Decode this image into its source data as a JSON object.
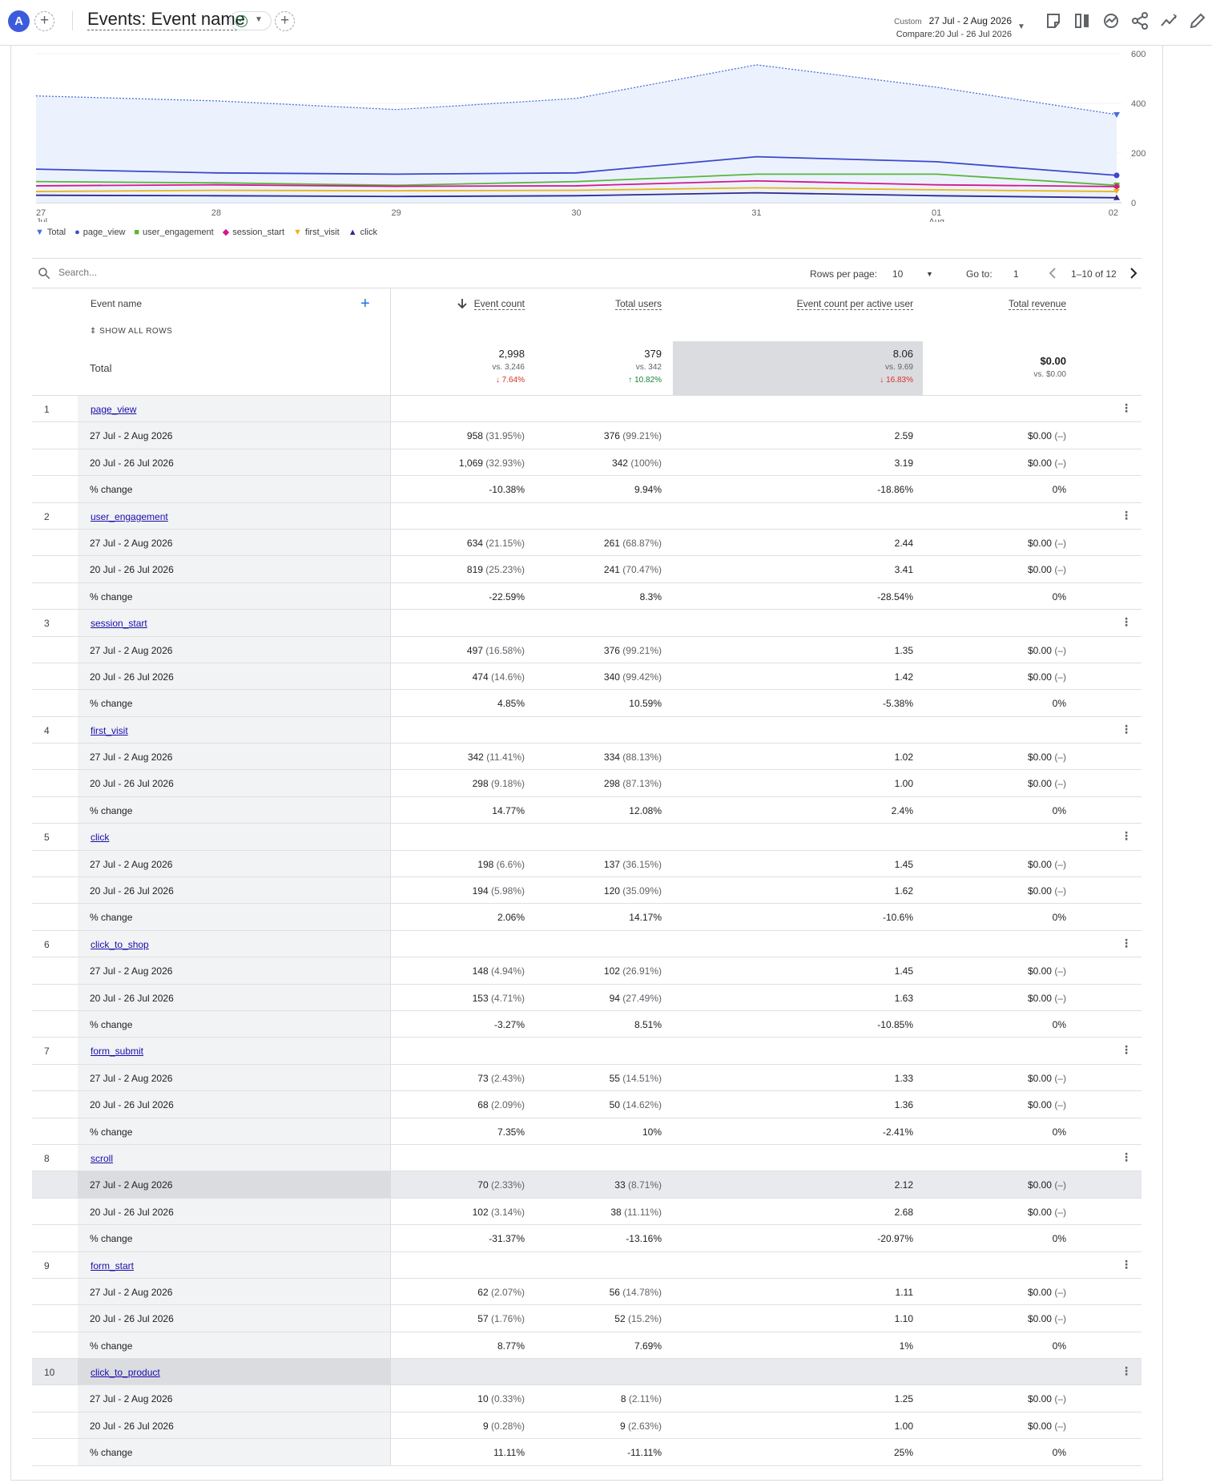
{
  "header": {
    "avatar_letter": "A",
    "add_label": "+",
    "title": "Events: Event name",
    "add_comparison_label": "+",
    "date_custom": "Custom",
    "date_range": "27 Jul - 2 Aug 2026",
    "compare_range": "Compare:20 Jul - 26 Jul 2026",
    "toolbar_icons": [
      "annotation-icon",
      "compare-columns-icon",
      "insights-icon",
      "share-icon",
      "trend-icon",
      "edit-icon"
    ]
  },
  "chart_data": {
    "type": "line",
    "x": [
      "27 Jul",
      "28",
      "29",
      "30",
      "31",
      "01 Aug",
      "02"
    ],
    "tick_labels": [
      [
        "27",
        "Jul"
      ],
      [
        "28",
        ""
      ],
      [
        "29",
        ""
      ],
      [
        "30",
        ""
      ],
      [
        "31",
        ""
      ],
      [
        "01",
        "Aug"
      ],
      [
        "02",
        ""
      ]
    ],
    "ylim": [
      0,
      600
    ],
    "yticks": [
      "600",
      "400",
      "200",
      "0"
    ],
    "ytick_values": [
      600,
      400,
      200,
      0
    ],
    "legend_position": "bottom-left",
    "series": [
      {
        "name": "Total",
        "color": "#4a6fd8",
        "style": "dotted-area",
        "values": [
          430,
          410,
          375,
          420,
          555,
          465,
          355
        ]
      },
      {
        "name": "page_view",
        "color": "#3b48cc",
        "values": [
          135,
          120,
          115,
          120,
          185,
          165,
          110
        ]
      },
      {
        "name": "user_engagement",
        "color": "#59b539",
        "values": [
          85,
          80,
          70,
          85,
          115,
          115,
          70
        ]
      },
      {
        "name": "session_start",
        "color": "#d4178a",
        "values": [
          68,
          72,
          66,
          68,
          88,
          72,
          65
        ]
      },
      {
        "name": "first_visit",
        "color": "#e8b61a",
        "values": [
          45,
          50,
          48,
          50,
          60,
          52,
          45
        ]
      },
      {
        "name": "click",
        "color": "#2f2a8a",
        "values": [
          30,
          28,
          25,
          28,
          40,
          28,
          20
        ]
      }
    ]
  },
  "search": {
    "placeholder": "Search..."
  },
  "pagination": {
    "rows_label": "Rows per page:",
    "rows_value": "10",
    "goto_label": "Go to:",
    "goto_value": "1",
    "range": "1–10 of 12"
  },
  "table": {
    "col_name": "Event name",
    "show_all": "SHOW ALL ROWS",
    "columns": [
      "Event count",
      "Total users",
      "Event count per active user",
      "Total revenue"
    ],
    "total": {
      "label": "Total",
      "values": [
        {
          "main": "2,998",
          "vs": "vs. 3,246",
          "change": "↓ 7.64%",
          "dir": "down"
        },
        {
          "main": "379",
          "vs": "vs. 342",
          "change": "↑ 10.82%",
          "dir": "up"
        },
        {
          "main": "8.06",
          "vs": "vs. 9.69",
          "change": "↓ 16.83%",
          "dir": "down"
        },
        {
          "main": "$0.00",
          "vs": "vs. $0.00",
          "change": "",
          "dir": ""
        }
      ]
    },
    "row_labels": [
      "27 Jul - 2 Aug 2026",
      "20 Jul - 26 Jul 2026",
      "% change"
    ],
    "groups": [
      {
        "num": "1",
        "name": "page_view",
        "rows": [
          [
            "958",
            "(31.95%)",
            "376",
            "(99.21%)",
            "2.59",
            "$0.00",
            "(–)"
          ],
          [
            "1,069",
            "(32.93%)",
            "342",
            "(100%)",
            "3.19",
            "$0.00",
            "(–)"
          ],
          [
            "-10.38%",
            "",
            "9.94%",
            "",
            "-18.86%",
            "0%",
            ""
          ]
        ]
      },
      {
        "num": "2",
        "name": "user_engagement",
        "rows": [
          [
            "634",
            "(21.15%)",
            "261",
            "(68.87%)",
            "2.44",
            "$0.00",
            "(–)"
          ],
          [
            "819",
            "(25.23%)",
            "241",
            "(70.47%)",
            "3.41",
            "$0.00",
            "(–)"
          ],
          [
            "-22.59%",
            "",
            "8.3%",
            "",
            "-28.54%",
            "0%",
            ""
          ]
        ]
      },
      {
        "num": "3",
        "name": "session_start",
        "rows": [
          [
            "497",
            "(16.58%)",
            "376",
            "(99.21%)",
            "1.35",
            "$0.00",
            "(–)"
          ],
          [
            "474",
            "(14.6%)",
            "340",
            "(99.42%)",
            "1.42",
            "$0.00",
            "(–)"
          ],
          [
            "4.85%",
            "",
            "10.59%",
            "",
            "-5.38%",
            "0%",
            ""
          ]
        ]
      },
      {
        "num": "4",
        "name": "first_visit",
        "rows": [
          [
            "342",
            "(11.41%)",
            "334",
            "(88.13%)",
            "1.02",
            "$0.00",
            "(–)"
          ],
          [
            "298",
            "(9.18%)",
            "298",
            "(87.13%)",
            "1.00",
            "$0.00",
            "(–)"
          ],
          [
            "14.77%",
            "",
            "12.08%",
            "",
            "2.4%",
            "0%",
            ""
          ]
        ]
      },
      {
        "num": "5",
        "name": "click",
        "rows": [
          [
            "198",
            "(6.6%)",
            "137",
            "(36.15%)",
            "1.45",
            "$0.00",
            "(–)"
          ],
          [
            "194",
            "(5.98%)",
            "120",
            "(35.09%)",
            "1.62",
            "$0.00",
            "(–)"
          ],
          [
            "2.06%",
            "",
            "14.17%",
            "",
            "-10.6%",
            "0%",
            ""
          ]
        ]
      },
      {
        "num": "6",
        "name": "click_to_shop",
        "rows": [
          [
            "148",
            "(4.94%)",
            "102",
            "(26.91%)",
            "1.45",
            "$0.00",
            "(–)"
          ],
          [
            "153",
            "(4.71%)",
            "94",
            "(27.49%)",
            "1.63",
            "$0.00",
            "(–)"
          ],
          [
            "-3.27%",
            "",
            "8.51%",
            "",
            "-10.85%",
            "0%",
            ""
          ]
        ]
      },
      {
        "num": "7",
        "name": "form_submit",
        "rows": [
          [
            "73",
            "(2.43%)",
            "55",
            "(14.51%)",
            "1.33",
            "$0.00",
            "(–)"
          ],
          [
            "68",
            "(2.09%)",
            "50",
            "(14.62%)",
            "1.36",
            "$0.00",
            "(–)"
          ],
          [
            "7.35%",
            "",
            "10%",
            "",
            "-2.41%",
            "0%",
            ""
          ]
        ]
      },
      {
        "num": "8",
        "name": "scroll",
        "rows": [
          [
            "70",
            "(2.33%)",
            "33",
            "(8.71%)",
            "2.12",
            "$0.00",
            "(–)"
          ],
          [
            "102",
            "(3.14%)",
            "38",
            "(11.11%)",
            "2.68",
            "$0.00",
            "(–)"
          ],
          [
            "-31.37%",
            "",
            "-13.16%",
            "",
            "-20.97%",
            "0%",
            ""
          ]
        ]
      },
      {
        "num": "9",
        "name": "form_start",
        "rows": [
          [
            "62",
            "(2.07%)",
            "56",
            "(14.78%)",
            "1.11",
            "$0.00",
            "(–)"
          ],
          [
            "57",
            "(1.76%)",
            "52",
            "(15.2%)",
            "1.10",
            "$0.00",
            "(–)"
          ],
          [
            "8.77%",
            "",
            "7.69%",
            "",
            "1%",
            "0%",
            ""
          ]
        ]
      },
      {
        "num": "10",
        "name": "click_to_product",
        "rows": [
          [
            "10",
            "(0.33%)",
            "8",
            "(2.11%)",
            "1.25",
            "$0.00",
            "(–)"
          ],
          [
            "9",
            "(0.28%)",
            "9",
            "(2.63%)",
            "1.00",
            "$0.00",
            "(–)"
          ],
          [
            "11.11%",
            "",
            "-11.11%",
            "",
            "25%",
            "0%",
            ""
          ]
        ]
      }
    ]
  }
}
